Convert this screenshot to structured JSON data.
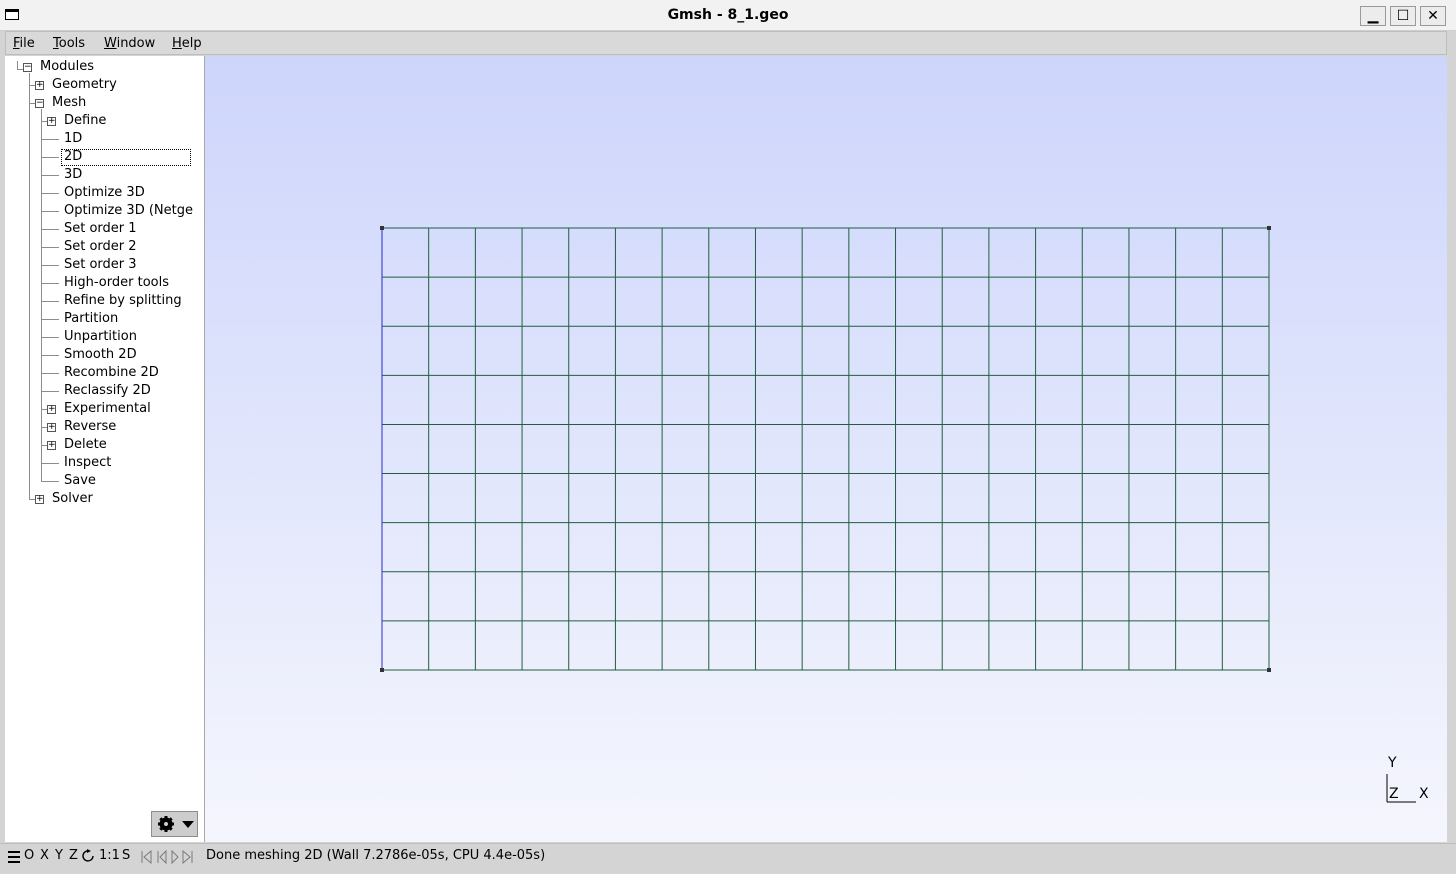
{
  "window": {
    "title": "Gmsh - 8_1.geo",
    "buttons": {
      "minimize": "▁",
      "maximize": "☐",
      "close": "✕"
    }
  },
  "menubar": {
    "items": [
      "File",
      "Tools",
      "Window",
      "Help"
    ]
  },
  "tree": {
    "root": "Modules",
    "geometry": "Geometry",
    "mesh": "Mesh",
    "mesh_items": [
      "Define",
      "1D",
      "2D",
      "3D",
      "Optimize 3D",
      "Optimize 3D (Netge",
      "Set order 1",
      "Set order 2",
      "Set order 3",
      "High-order tools",
      "Refine by splitting",
      "Partition",
      "Unpartition",
      "Smooth 2D",
      "Recombine 2D",
      "Reclassify 2D",
      "Experimental",
      "Reverse",
      "Delete",
      "Inspect",
      "Save"
    ],
    "expandable_mesh_items": [
      "Define",
      "Experimental",
      "Reverse",
      "Delete"
    ],
    "selected": "2D",
    "solver": "Solver"
  },
  "graphics": {
    "mesh": {
      "columns": 19,
      "rows": 9,
      "line_color": "#1f5f3f",
      "left_edge_color": "#2a2ad0"
    },
    "axes": {
      "y": "Y",
      "z": "Z",
      "x": "X"
    }
  },
  "statusbar": {
    "buttons": [
      "O",
      "X",
      "Y",
      "Z",
      "1:1",
      "S"
    ],
    "message": "Done meshing 2D (Wall 7.2786e-05s, CPU 4.4e-05s)"
  },
  "colors": {
    "gradient_top": "#cdd5fb",
    "gradient_bottom": "#f5f6fd"
  }
}
